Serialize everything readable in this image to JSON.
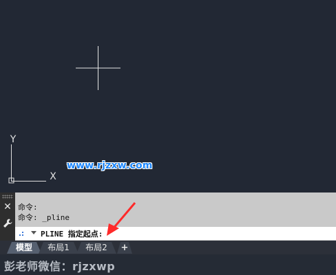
{
  "canvas": {
    "background": "#222834",
    "crosshair_color": "#e6e6e6",
    "ucs": {
      "y_label": "Y",
      "x_label": "X"
    }
  },
  "watermark": {
    "text": "www.rjzxw.com",
    "color": "#1e88ff"
  },
  "command_line": {
    "history": [
      "命令:",
      "命令: _pline"
    ],
    "prompt": "PLINE 指定起点:",
    "icons": {
      "close": "close-icon",
      "settings": "wrench-icon",
      "recent": "dots-icon",
      "dropdown": "chevron-down-icon"
    }
  },
  "tabs": [
    {
      "label": "模型",
      "active": true
    },
    {
      "label": "布局1",
      "active": false
    },
    {
      "label": "布局2",
      "active": false
    },
    {
      "label": "+",
      "active": false
    }
  ],
  "bottom_watermark": {
    "text": "彭老师微信：rjzxwp"
  },
  "annotation": {
    "arrow_color": "#ff2a2a"
  }
}
